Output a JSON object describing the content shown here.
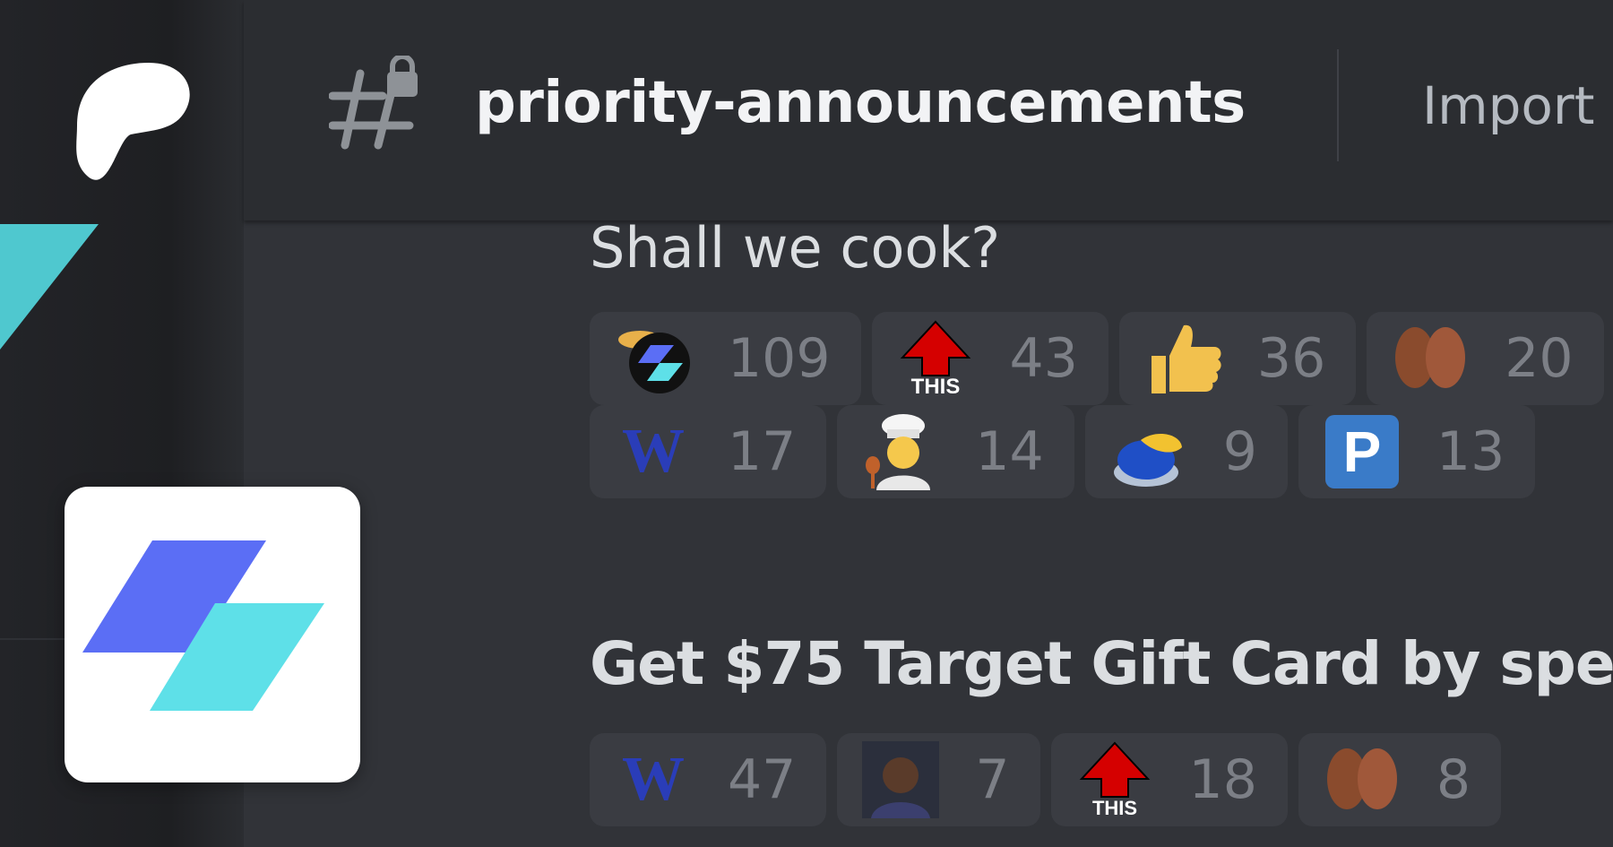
{
  "header": {
    "channel_name": "priority-announcements",
    "topic": "Import"
  },
  "messages": {
    "first": {
      "text": "Shall we cook?",
      "reactions_row1": [
        {
          "icon": "server-logo-emoji",
          "count": "109"
        },
        {
          "icon": "this-arrow-emoji",
          "label": "THIS",
          "count": "43"
        },
        {
          "icon": "thumbs-up-emoji",
          "count": "36"
        },
        {
          "icon": "kiss-emoji",
          "count": "20"
        }
      ],
      "reactions_row2": [
        {
          "icon": "w-emoji",
          "label": "W",
          "count": "17"
        },
        {
          "icon": "chef-emoji",
          "count": "14"
        },
        {
          "icon": "buzzer-emoji",
          "count": "9"
        },
        {
          "icon": "p-emoji",
          "label": "P",
          "count": "13"
        }
      ]
    },
    "second": {
      "title": "Get $75 Target Gift Card by spe",
      "reactions": [
        {
          "icon": "w-emoji",
          "label": "W",
          "count": "47"
        },
        {
          "icon": "person-photo-emoji",
          "count": "7"
        },
        {
          "icon": "this-arrow-emoji",
          "label": "THIS",
          "count": "18"
        },
        {
          "icon": "kiss-emoji",
          "count": "8"
        }
      ]
    }
  },
  "colors": {
    "blurple": "#5865f2",
    "teal": "#59dde6",
    "background": "#313338"
  }
}
